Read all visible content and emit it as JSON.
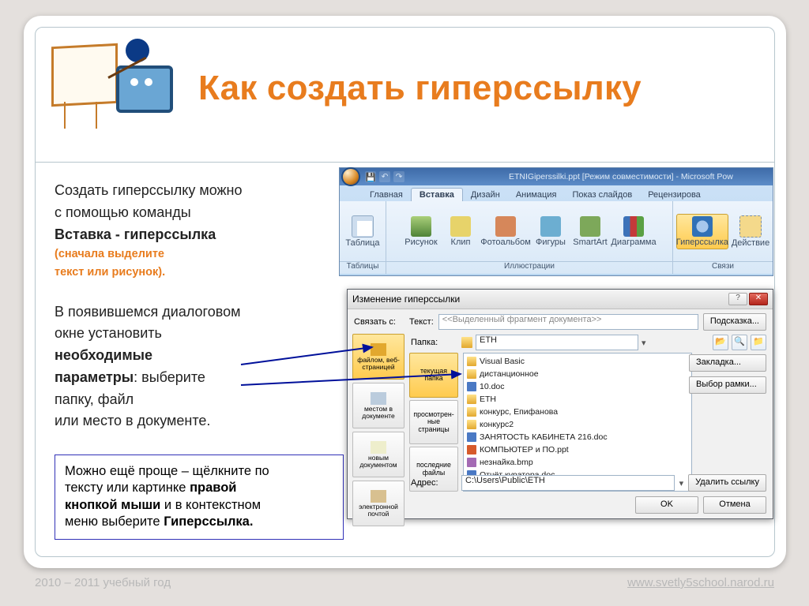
{
  "header": {
    "title": "Как создать гиперссылку"
  },
  "left": {
    "p1a": "Создать гиперссылку можно",
    "p1b": "с помощью команды",
    "p1c": "Вставка  - гиперссылка",
    "p1d": "(сначала выделите",
    "p1e": "текст или рисунок).",
    "p2a": "В появившемся диалоговом",
    "p2b": "окне установить",
    "p2c": "необходимые",
    "p2d": "параметры",
    "p2e": ": выберите",
    "p2f": "папку, файл",
    "p2g": "или место в документе."
  },
  "tip": {
    "t1": "Можно ещё проще – щёлкните по",
    "t2a": "тексту или  картинке ",
    "t2b": "правой",
    "t3a": "кнопкой мыши",
    "t3b": " и в контекстном",
    "t4a": "меню выберите ",
    "t4b": "Гиперссылка."
  },
  "ribbon": {
    "doc": "ETNIGiperssilki.ppt [Режим совместимости] - Microsoft Pow",
    "tabs": [
      "Главная",
      "Вставка",
      "Дизайн",
      "Анимация",
      "Показ слайдов",
      "Рецензирова"
    ],
    "groups": {
      "g1": {
        "label": "Таблицы",
        "btns": [
          "Таблица"
        ]
      },
      "g2": {
        "label": "Иллюстрации",
        "btns": [
          "Рисунок",
          "Клип",
          "Фотоальбом",
          "Фигуры",
          "SmartArt",
          "Диаграмма"
        ]
      },
      "g3": {
        "label": "Связи",
        "btns": [
          "Гиперссылка",
          "Действие"
        ]
      }
    }
  },
  "dlg": {
    "title": "Изменение гиперссылки",
    "linkwith": "Связать с:",
    "text_lbl": "Текст:",
    "text_ph": "<<Выделенный фрагмент документа>>",
    "hint_btn": "Подсказка...",
    "folder_lbl": "Папка:",
    "folder_val": "ETH",
    "leftbar": [
      "файлом, веб-страницей",
      "местом в документе",
      "новым документом",
      "электронной почтой"
    ],
    "midbar": [
      "текущая папка",
      "просмотрен-ные страницы",
      "последние файлы"
    ],
    "files": [
      {
        "ic": "folder",
        "n": "Visual Basic"
      },
      {
        "ic": "folder",
        "n": "дистанционное"
      },
      {
        "ic": "doc",
        "n": "10.doc"
      },
      {
        "ic": "folder",
        "n": "ETH"
      },
      {
        "ic": "folder",
        "n": "конкурс, Епифанова"
      },
      {
        "ic": "folder",
        "n": "конкурс2"
      },
      {
        "ic": "doc",
        "n": "ЗАНЯТОСТЬ КАБИНЕТА   216.doc"
      },
      {
        "ic": "ppt",
        "n": "КОМПЬЮТЕР и ПО.ppt"
      },
      {
        "ic": "bmp",
        "n": "незнайка.bmp"
      },
      {
        "ic": "doc",
        "n": "Отчёт куратора.doc"
      }
    ],
    "bookmark": "Закладка...",
    "frame": "Выбор рамки...",
    "addr_lbl": "Адрес:",
    "addr_val": "C:\\Users\\Public\\ETH",
    "remove": "Удалить ссылку",
    "ok": "OK",
    "cancel": "Отмена"
  },
  "footer": {
    "left": "2010 – 2011 учебный год",
    "right": "www.svetly5school.narod.ru"
  }
}
